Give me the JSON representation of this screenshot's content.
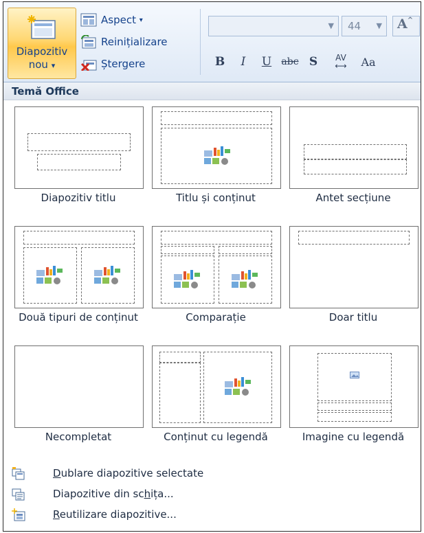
{
  "ribbon": {
    "new_slide": {
      "line1": "Diapozitiv",
      "line2": "nou",
      "arrow": "▾"
    },
    "layout": {
      "label": "Aspect",
      "arrow": "▾"
    },
    "reset": {
      "label": "Reinițializare"
    },
    "delete": {
      "label": "Ștergere"
    },
    "font_size": "44",
    "grow_font": "A",
    "format": {
      "bold": "B",
      "italic": "I",
      "underline": "U",
      "strike": "abc",
      "shadow": "S",
      "spacing_top": "AV",
      "spacing_bottom": "⟷",
      "change_case": "Aa"
    }
  },
  "section_title": "Temă Office",
  "layouts": [
    {
      "label": "Diapozitiv titlu"
    },
    {
      "label": "Titlu și conținut"
    },
    {
      "label": "Antet secțiune"
    },
    {
      "label": "Două tipuri de conținut"
    },
    {
      "label": "Comparație"
    },
    {
      "label": "Doar titlu"
    },
    {
      "label": "Necompletat"
    },
    {
      "label": "Conținut cu legendă"
    },
    {
      "label": "Imagine cu legendă"
    }
  ],
  "menu": [
    {
      "pre": "",
      "key": "D",
      "post": "ublare diapozitive selectate"
    },
    {
      "pre": "Diapozitive din sc",
      "key": "h",
      "post": "ița..."
    },
    {
      "pre": "",
      "key": "R",
      "post": "eutilizare diapozitive..."
    }
  ],
  "colors": {
    "accent": "#15428b",
    "hover": "#ffd772"
  }
}
